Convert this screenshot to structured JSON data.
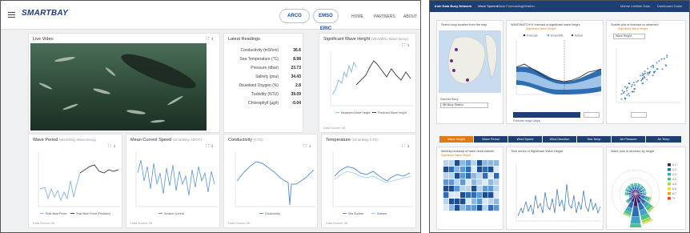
{
  "left_app": {
    "brand": "SMARTBAY",
    "partner_badges": [
      "ARCO",
      "EMSO ERIC"
    ],
    "nav": [
      "HOME",
      "PARTNERS",
      "ABOUT"
    ],
    "video": {
      "title": "Live Video"
    },
    "latest": {
      "title": "Latest Readings",
      "rows": [
        {
          "label": "Conductivity (mS/cm)",
          "value": "36.6"
        },
        {
          "label": "Sea Temperature (°C)",
          "value": "8.98"
        },
        {
          "label": "Pressure (dbar)",
          "value": "23.73"
        },
        {
          "label": "Salinity (psu)",
          "value": "34.43"
        },
        {
          "label": "Dissolved Oxygen (%)",
          "value": "2.8"
        },
        {
          "label": "Turbidity (NTU)",
          "value": "39.09"
        },
        {
          "label": "Chlorophyll (µg/l)",
          "value": "-0.04"
        }
      ]
    },
    "swh": {
      "title": "Significant Wave Height",
      "sub": "(WestWay Wave Buoy)",
      "legend": [
        "Measured Wave Height",
        "Predicted Wave Height"
      ],
      "source": "Data Source: MI"
    },
    "period": {
      "title": "Wave Period",
      "sub": "(WestWay Wave Buoy)",
      "legend": [
        "Peak Wave Period",
        "Peak Wave Period (Predicted)"
      ],
      "source": "Data Source: MI"
    },
    "current": {
      "title": "Mean Current Speed",
      "sub": "(SmartBay ADCP)",
      "legend": [
        "Surface Current"
      ],
      "source": "Data Source: MI"
    },
    "conductivity": {
      "title": "Conductivity",
      "sub": "(CTD)",
      "legend": [
        "Conductivity"
      ],
      "source": "Data Source: MI"
    },
    "temperature": {
      "title": "Temperature",
      "sub": "(SmartBay CTD)",
      "legend": [
        "Sea Surface",
        "Subsea"
      ],
      "source": "Data Source: MI"
    }
  },
  "right_app": {
    "brand": "Irish Data Buoy Network",
    "nav_items": [
      "Wave Spectra",
      "Wave Forecasting",
      "Weather"
    ],
    "nav_right": [
      "Marine Institute Data",
      "Dashboard Guide"
    ],
    "map_title": "Select buoy location from the map",
    "map_select": "M6 Buoy Station",
    "map_select_label": "Selected Buoy",
    "forecast_title": "WAVEWATCH III forecast of significant wave height",
    "forecast_title_accent": "Significant Wave Height",
    "forecast_legend": [
      "Forecast",
      "Ensemble",
      "Actual"
    ],
    "forecast_slider_label": "Forecast range (days)",
    "scatter_title": "Scatter plot of forecast vs observed",
    "scatter_title_accent": "Significant Wave Height",
    "scatter_select": "Wave Height",
    "tabs": [
      "Wave Height",
      "Wave Period",
      "Wind Speed",
      "Wind Direction",
      "Sea Temp",
      "Air Pressure",
      "Air Temp"
    ],
    "lower_titles": [
      "Monthly heatmap of wave observations",
      "Time series of Significant Wave Height",
      "Wave rose of direction by height"
    ],
    "lower_accent": "Significant Wave Height",
    "rose_legend": [
      "0-1",
      "1-2",
      "2-3",
      "3-4",
      "4-5",
      "5-6",
      "6-7",
      "7+"
    ]
  }
}
